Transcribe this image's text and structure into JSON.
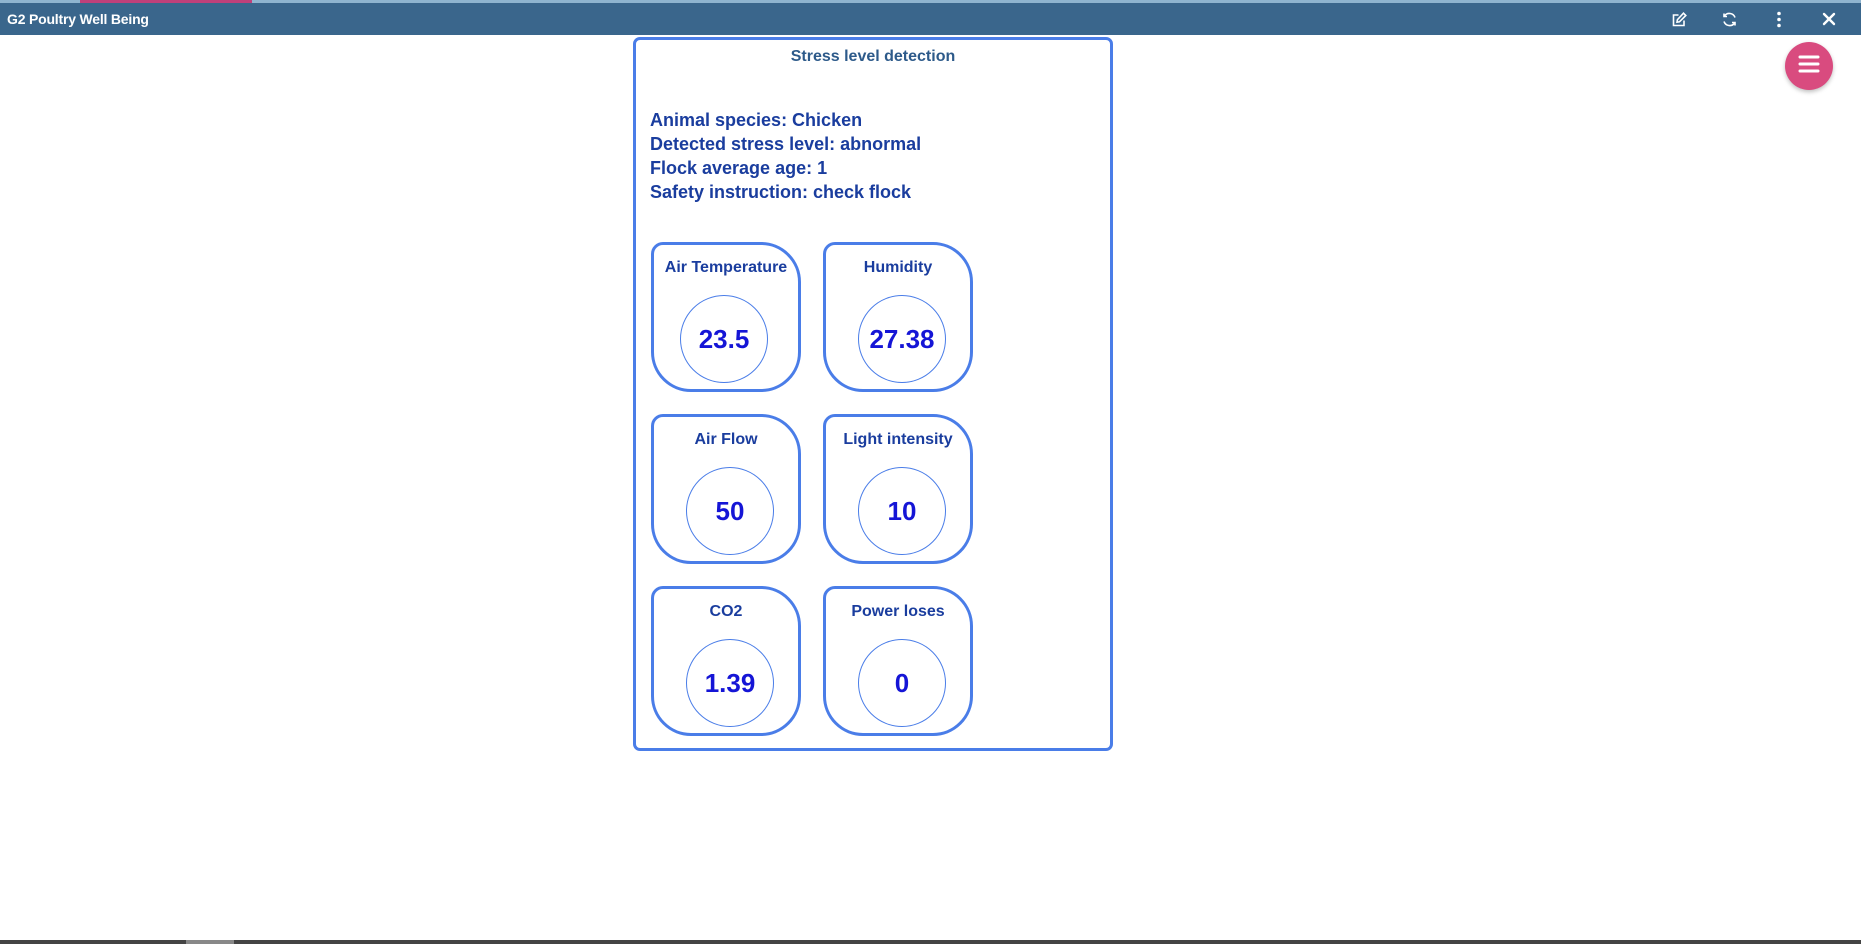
{
  "window": {
    "title": "G2 Poultry Well Being",
    "actions": [
      {
        "name": "edit-icon"
      },
      {
        "name": "refresh-icon"
      },
      {
        "name": "more-vertical-icon"
      },
      {
        "name": "close-icon"
      }
    ]
  },
  "menu_button": {
    "icon": "menu-icon"
  },
  "panel": {
    "title": "Stress level detection",
    "info": {
      "species": "Animal species: Chicken",
      "stress": "Detected stress level: abnormal",
      "age": "Flock average age: 1",
      "instruction": "Safety instruction: check flock"
    },
    "metrics": [
      {
        "label": "Air Temperature",
        "value": "23.5"
      },
      {
        "label": "Humidity",
        "value": "27.38"
      },
      {
        "label": "Air Flow",
        "value": "50"
      },
      {
        "label": "Light intensity",
        "value": "10"
      },
      {
        "label": "CO2",
        "value": "1.39"
      },
      {
        "label": "Power loses",
        "value": "0"
      }
    ]
  },
  "colors": {
    "titlebar": "#3a668c",
    "accent": "#d94b7f",
    "border": "#4a7de8",
    "text": "#1a3d9e",
    "value": "#1515d6"
  }
}
